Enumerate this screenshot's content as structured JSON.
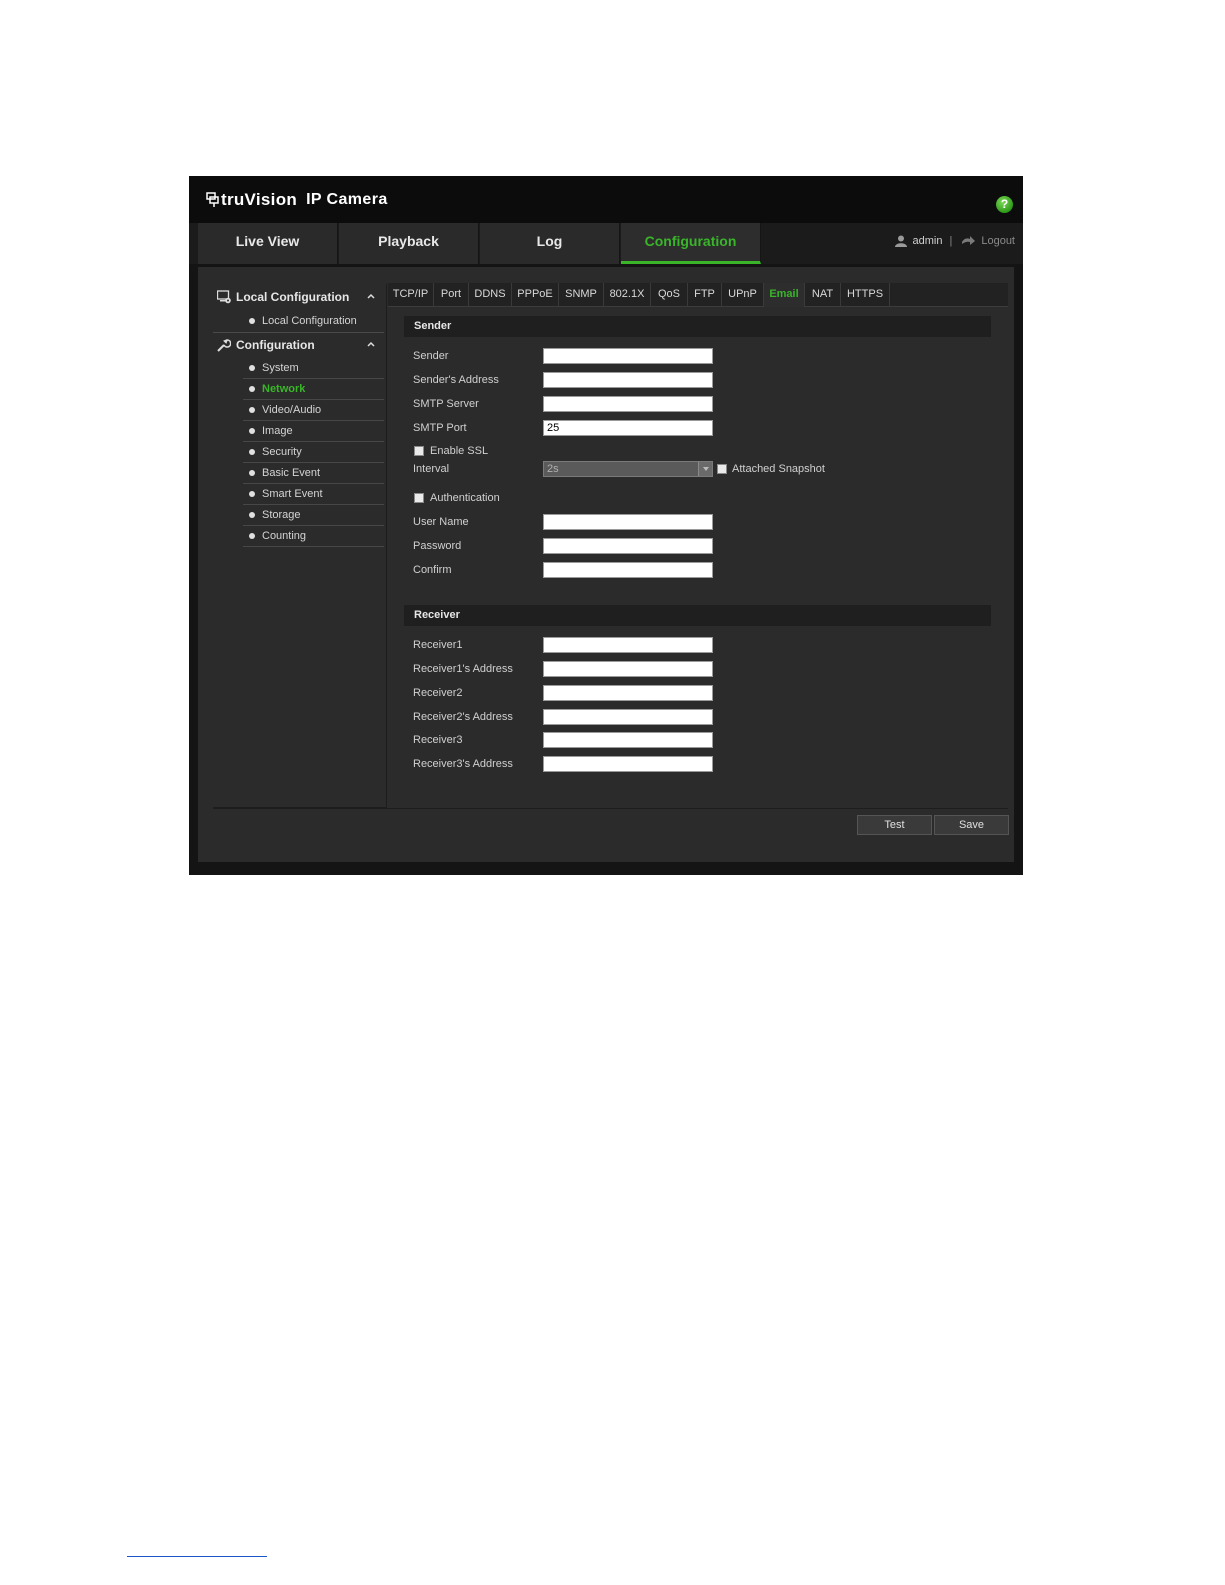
{
  "app": {
    "brand": "truVision",
    "product": "IP Camera",
    "help_icon": "?"
  },
  "nav": {
    "tabs": [
      {
        "label": "Live View"
      },
      {
        "label": "Playback"
      },
      {
        "label": "Log"
      },
      {
        "label": "Configuration",
        "active": true
      }
    ],
    "user": "admin",
    "separator": "|",
    "logout": "Logout"
  },
  "sidebar": {
    "local_header": "Local Configuration",
    "local_items": [
      "Local Configuration"
    ],
    "config_header": "Configuration",
    "config_items": [
      "System",
      "Network",
      "Video/Audio",
      "Image",
      "Security",
      "Basic Event",
      "Smart Event",
      "Storage",
      "Counting"
    ],
    "active_item": "Network"
  },
  "subtabs": [
    "TCP/IP",
    "Port",
    "DDNS",
    "PPPoE",
    "SNMP",
    "802.1X",
    "QoS",
    "FTP",
    "UPnP",
    "Email",
    "NAT",
    "HTTPS"
  ],
  "active_subtab": "Email",
  "sender": {
    "header": "Sender",
    "sender_label": "Sender",
    "sender_value": "",
    "address_label": "Sender's Address",
    "address_value": "",
    "smtp_server_label": "SMTP Server",
    "smtp_server_value": "",
    "smtp_port_label": "SMTP Port",
    "smtp_port_value": "25",
    "enable_ssl_label": "Enable SSL",
    "enable_ssl_checked": false,
    "interval_label": "Interval",
    "interval_value": "2s",
    "attached_snapshot_label": "Attached Snapshot",
    "attached_snapshot_checked": false,
    "authentication_label": "Authentication",
    "authentication_checked": false,
    "username_label": "User Name",
    "username_value": "",
    "password_label": "Password",
    "password_value": "",
    "confirm_label": "Confirm",
    "confirm_value": ""
  },
  "receiver": {
    "header": "Receiver",
    "r1_label": "Receiver1",
    "r1_value": "",
    "r1_addr_label": "Receiver1's Address",
    "r1_addr_value": "",
    "r2_label": "Receiver2",
    "r2_value": "",
    "r2_addr_label": "Receiver2's Address",
    "r2_addr_value": "",
    "r3_label": "Receiver3",
    "r3_value": "",
    "r3_addr_label": "Receiver3's Address",
    "r3_addr_value": ""
  },
  "buttons": {
    "test": "Test",
    "save": "Save"
  },
  "colors": {
    "accent": "#3ab52a",
    "background": "#2b2b2b",
    "header": "#0c0c0c"
  }
}
